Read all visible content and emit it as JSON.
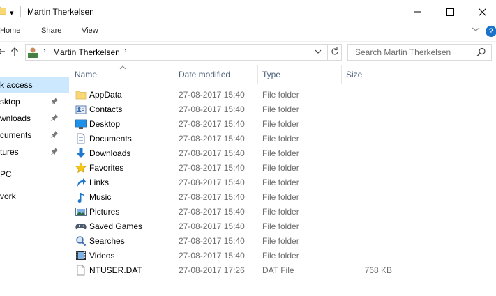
{
  "window": {
    "title": "Martin Therkelsen",
    "qa_glyph": "▾"
  },
  "ribbon": {
    "tabs": [
      "Home",
      "Share",
      "View"
    ],
    "help_glyph": "?"
  },
  "address": {
    "crumb": "Martin Therkelsen",
    "separator": "›",
    "icon": "user-folder-icon"
  },
  "search": {
    "placeholder": "Search Martin Therkelsen"
  },
  "nav_pane": [
    {
      "label": "k access",
      "pinned": false,
      "selected": true
    },
    {
      "label": "sktop",
      "pinned": true
    },
    {
      "label": "wnloads",
      "pinned": true
    },
    {
      "label": "cuments",
      "pinned": true
    },
    {
      "label": "tures",
      "pinned": true
    },
    {
      "label": "PC",
      "pinned": false
    },
    {
      "label": "vork",
      "pinned": false
    }
  ],
  "columns": {
    "name": "Name",
    "date": "Date modified",
    "type": "Type",
    "size": "Size"
  },
  "files": [
    {
      "name": "AppData",
      "date": "27-08-2017 15:40",
      "type": "File folder",
      "size": "",
      "icon": "folder-icon"
    },
    {
      "name": "Contacts",
      "date": "27-08-2017 15:40",
      "type": "File folder",
      "size": "",
      "icon": "contacts-icon"
    },
    {
      "name": "Desktop",
      "date": "27-08-2017 15:40",
      "type": "File folder",
      "size": "",
      "icon": "desktop-icon"
    },
    {
      "name": "Documents",
      "date": "27-08-2017 15:40",
      "type": "File folder",
      "size": "",
      "icon": "documents-icon"
    },
    {
      "name": "Downloads",
      "date": "27-08-2017 15:40",
      "type": "File folder",
      "size": "",
      "icon": "downloads-icon"
    },
    {
      "name": "Favorites",
      "date": "27-08-2017 15:40",
      "type": "File folder",
      "size": "",
      "icon": "favorites-icon"
    },
    {
      "name": "Links",
      "date": "27-08-2017 15:40",
      "type": "File folder",
      "size": "",
      "icon": "links-icon"
    },
    {
      "name": "Music",
      "date": "27-08-2017 15:40",
      "type": "File folder",
      "size": "",
      "icon": "music-icon"
    },
    {
      "name": "Pictures",
      "date": "27-08-2017 15:40",
      "type": "File folder",
      "size": "",
      "icon": "pictures-icon"
    },
    {
      "name": "Saved Games",
      "date": "27-08-2017 15:40",
      "type": "File folder",
      "size": "",
      "icon": "saved-games-icon"
    },
    {
      "name": "Searches",
      "date": "27-08-2017 15:40",
      "type": "File folder",
      "size": "",
      "icon": "searches-icon"
    },
    {
      "name": "Videos",
      "date": "27-08-2017 15:40",
      "type": "File folder",
      "size": "",
      "icon": "videos-icon"
    },
    {
      "name": "NTUSER.DAT",
      "date": "27-08-2017 17:26",
      "type": "DAT File",
      "size": "768 KB",
      "icon": "file-icon"
    }
  ],
  "colors": {
    "selection": "#cce8ff",
    "header_text": "#4c607a",
    "folder_yellow": "#f8d775",
    "accent_blue": "#1a73c9"
  }
}
